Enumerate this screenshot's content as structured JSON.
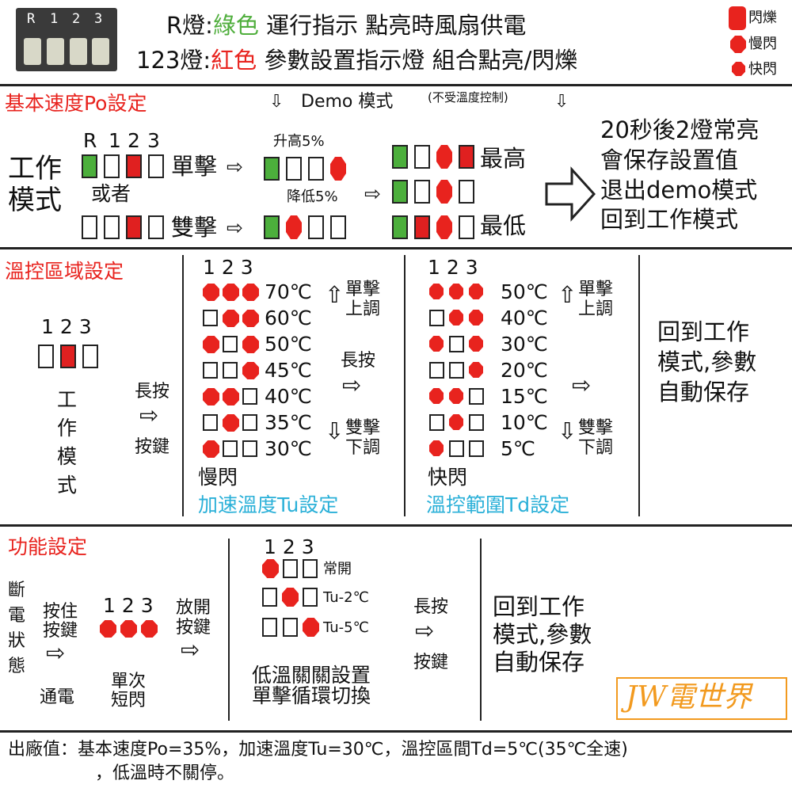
{
  "header": {
    "r_lamp": "R燈:",
    "green_word": "綠色",
    "r_desc": "運行指示 點亮時風扇供電",
    "lamp123": "123燈:",
    "red_word": "紅色",
    "lamp123_desc": "參數設置指示燈 組合點亮/閃爍",
    "board_labels": [
      "R",
      "1",
      "2",
      "3"
    ],
    "legend": [
      "閃爍",
      "慢閃",
      "快閃"
    ]
  },
  "base": {
    "title": "基本速度Po設定",
    "demo": "Demo 模式",
    "demo_note": "(不受溫度控制)",
    "labels": [
      "R",
      "1",
      "2",
      "3"
    ],
    "mode": [
      "工作",
      "模式"
    ],
    "or": "或者",
    "single": "單擊",
    "double": "雙擊",
    "up": "升高5%",
    "down": "降低5%",
    "max": "最高",
    "min": "最低",
    "result": [
      "20秒後2燈常亮",
      "會保存設置值",
      "退出demo模式",
      "回到工作模式"
    ],
    "colors": {
      "green": "#4caf3c",
      "red": "#e02020"
    }
  },
  "temp": {
    "title": "溫控區域設定",
    "labels": "1 2 3",
    "mode": [
      "工",
      "作",
      "模",
      "式"
    ],
    "long": "長按",
    "key": "按鍵",
    "col1_head": "1 2 3",
    "col1": [
      "70℃",
      "60℃",
      "50℃",
      "45℃",
      "40℃",
      "35℃",
      "30℃"
    ],
    "col1_speed": "慢閃",
    "col1_title": "加速溫度Tu設定",
    "col2_head": "1 2 3",
    "col2": [
      "50℃",
      "40℃",
      "30℃",
      "20℃",
      "15℃",
      "10℃",
      "5℃"
    ],
    "col2_speed": "快閃",
    "col2_title": "溫控範圍Td設定",
    "single": [
      "單擊",
      "上調"
    ],
    "double": [
      "雙擊",
      "下調"
    ],
    "result": [
      "回到工作",
      "模式,參數",
      "自動保存"
    ]
  },
  "func": {
    "title": "功能設定",
    "poweroff": [
      "斷",
      "電",
      "狀",
      "態"
    ],
    "hold": [
      "按住",
      "按鍵"
    ],
    "poweron": "通電",
    "head": "1 2 3",
    "flash": [
      "單次",
      "短閃"
    ],
    "release": [
      "放開",
      "按鍵"
    ],
    "opts": [
      "常開",
      "Tu-2℃",
      "Tu-5℃"
    ],
    "desc": [
      "低溫關關設置",
      "單擊循環切換"
    ],
    "long": "長按",
    "key": "按鍵",
    "result": [
      "回到工作",
      "模式,參數",
      "自動保存"
    ],
    "logo": "JW電世界"
  },
  "footer": {
    "line1": "出廠值：基本速度Po=35%，加速溫度Tu=30℃，溫控區間Td=5℃(35℃全速)",
    "line2": "，低溫時不關停。"
  }
}
